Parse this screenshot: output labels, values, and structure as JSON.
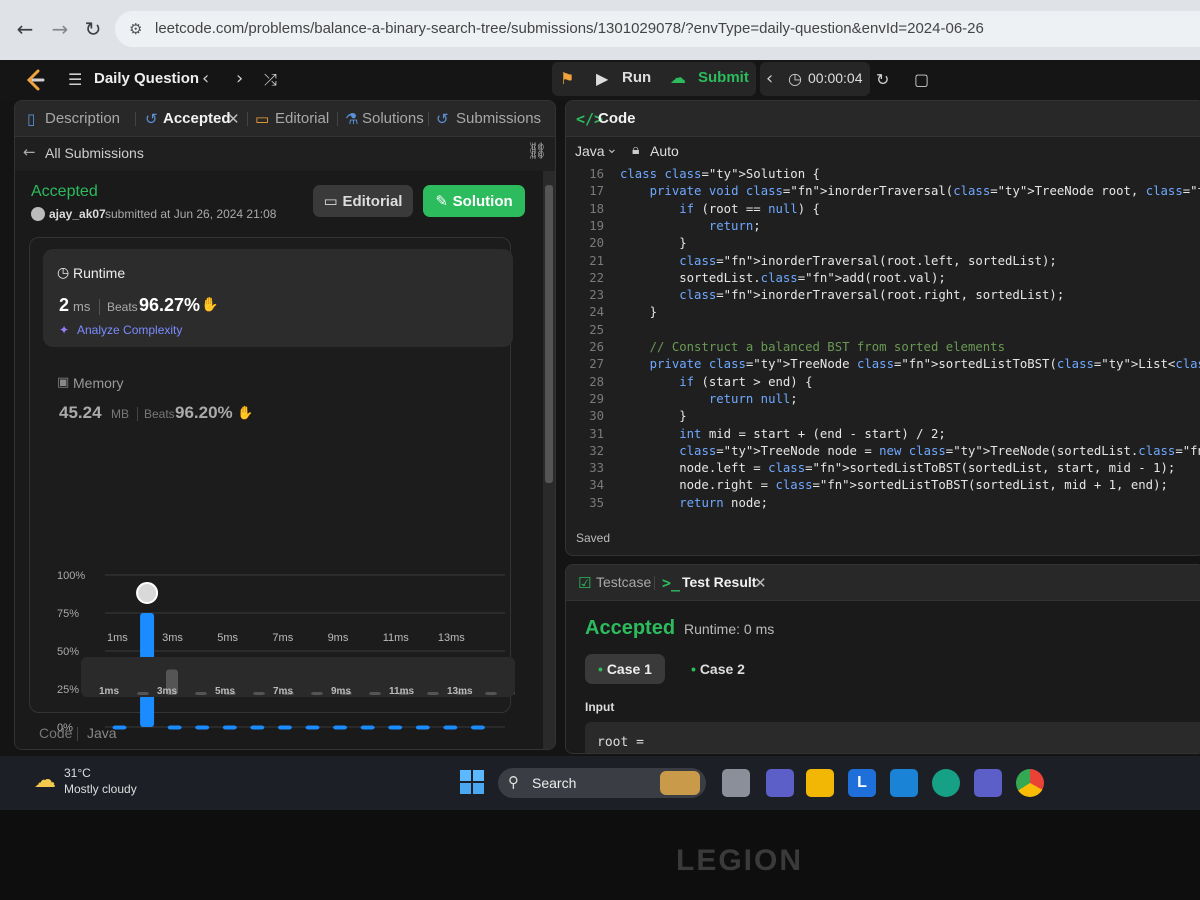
{
  "browser": {
    "url": "leetcode.com/problems/balance-a-binary-search-tree/submissions/1301029078/?envType=daily-question&envId=2024-06-26"
  },
  "header": {
    "title": "Daily Question",
    "run_label": "Run",
    "submit_label": "Submit",
    "timer": "00:00:04"
  },
  "left_tabs": {
    "description": "Description",
    "accepted": "Accepted",
    "editorial": "Editorial",
    "solutions": "Solutions",
    "submissions": "Submissions"
  },
  "submission": {
    "back_label": "All Submissions",
    "status": "Accepted",
    "user": "ajay_ak07",
    "submitted_text": "submitted at Jun 26, 2024 21:08",
    "editorial_btn": "Editorial",
    "solution_btn": "Solution"
  },
  "runtime": {
    "label": "Runtime",
    "value": "2",
    "unit": "ms",
    "beats_label": "Beats",
    "beats": "96.27%",
    "analyze": "Analyze Complexity"
  },
  "memory": {
    "label": "Memory",
    "value": "45.24",
    "unit": "MB",
    "beats_label": "Beats",
    "beats": "96.20%"
  },
  "chart_data": {
    "type": "bar",
    "categories": [
      "1ms",
      "2ms",
      "3ms",
      "4ms",
      "5ms",
      "6ms",
      "7ms",
      "8ms",
      "9ms",
      "10ms",
      "11ms",
      "12ms",
      "13ms",
      "14ms"
    ],
    "x_tick_labels": [
      "1ms",
      "3ms",
      "5ms",
      "7ms",
      "9ms",
      "11ms",
      "13ms"
    ],
    "values": [
      1,
      75,
      1,
      1,
      1,
      1,
      1,
      1,
      1,
      1,
      1,
      1,
      1,
      1
    ],
    "y_tick_labels": [
      "100%",
      "75%",
      "50%",
      "25%",
      "0%"
    ],
    "ylim": [
      0,
      100
    ],
    "highlight_index": 1,
    "bar_color": "#1a8cff",
    "grid": true
  },
  "left_footer": {
    "code_label": "Code",
    "lang": "Java"
  },
  "code_panel": {
    "title": "Code",
    "language": "Java",
    "mode": "Auto",
    "saved": "Saved",
    "lines": [
      {
        "n": "16",
        "t": "class Solution {"
      },
      {
        "n": "17",
        "t": "    private void inorderTraversal(TreeNode root, List<Integer> sortedList) {"
      },
      {
        "n": "18",
        "t": "        if (root == null) {"
      },
      {
        "n": "19",
        "t": "            return;"
      },
      {
        "n": "20",
        "t": "        }"
      },
      {
        "n": "21",
        "t": "        inorderTraversal(root.left, sortedList);"
      },
      {
        "n": "22",
        "t": "        sortedList.add(root.val);"
      },
      {
        "n": "23",
        "t": "        inorderTraversal(root.right, sortedList);"
      },
      {
        "n": "24",
        "t": "    }"
      },
      {
        "n": "25",
        "t": ""
      },
      {
        "n": "26",
        "t": "    // Construct a balanced BST from sorted elements"
      },
      {
        "n": "27",
        "t": "    private TreeNode sortedListToBST(List<Integer> sortedList, int start, int end) {"
      },
      {
        "n": "28",
        "t": "        if (start > end) {"
      },
      {
        "n": "29",
        "t": "            return null;"
      },
      {
        "n": "30",
        "t": "        }"
      },
      {
        "n": "31",
        "t": "        int mid = start + (end - start) / 2;"
      },
      {
        "n": "32",
        "t": "        TreeNode node = new TreeNode(sortedList.get(mid));"
      },
      {
        "n": "33",
        "t": "        node.left = sortedListToBST(sortedList, start, mid - 1);"
      },
      {
        "n": "34",
        "t": "        node.right = sortedListToBST(sortedList, mid + 1, end);"
      },
      {
        "n": "35",
        "t": "        return node;"
      }
    ]
  },
  "test_panel": {
    "testcase_tab": "Testcase",
    "result_tab": "Test Result",
    "status": "Accepted",
    "runtime": "Runtime: 0 ms",
    "case1": "Case 1",
    "case2": "Case 2",
    "input_label": "Input",
    "input_value": "root ="
  },
  "taskbar": {
    "temp": "31°C",
    "weather": "Mostly cloudy",
    "search": "Search"
  },
  "laptop": {
    "brand": "LEGION"
  }
}
